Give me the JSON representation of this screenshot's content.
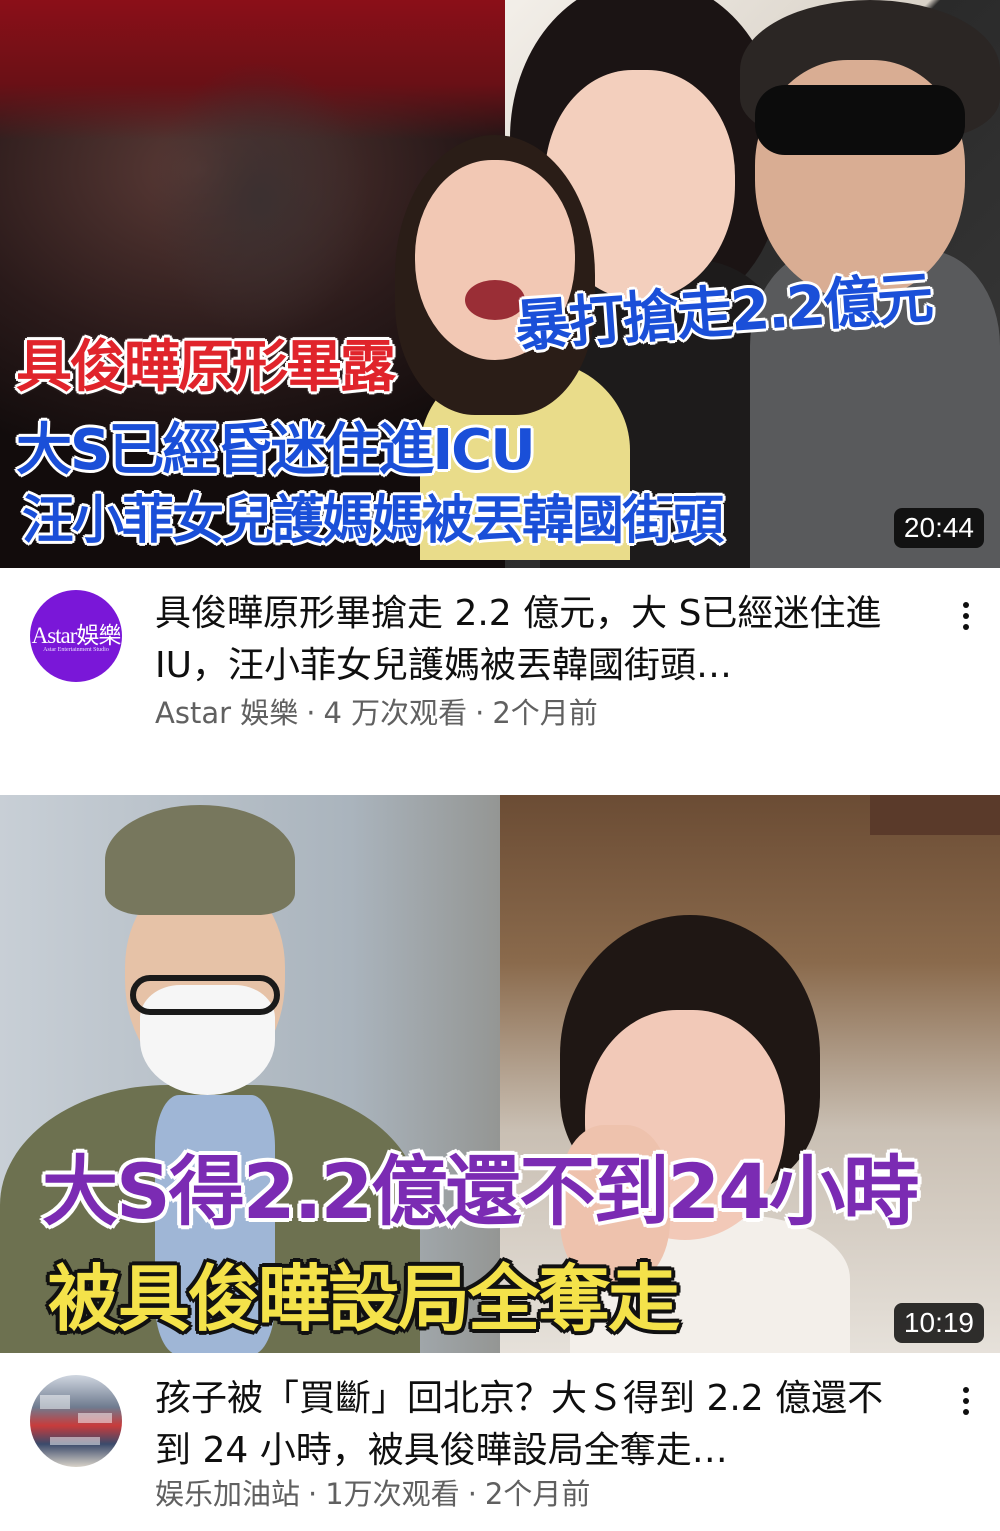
{
  "videos": [
    {
      "thumbnail_text": {
        "line1": "具俊曄原形畢露",
        "line2": "大S已經昏迷住進ICU",
        "line3": "汪小菲女兒護媽媽被丟韓國街頭",
        "line4": "暴打搶走2.2億元"
      },
      "duration": "20:44",
      "avatar_text": "Astar娛樂",
      "avatar_subtext": "Astar Entertainment Studio",
      "title": "具俊曄原形畢搶走 2.2 億元，大 S已經迷住進 IU，汪小菲女兒護媽被丟韓國街頭…",
      "channel": "Astar 娛樂",
      "views": "4 万次观看",
      "age": "2个月前",
      "separator": "·"
    },
    {
      "thumbnail_text": {
        "line1": "大S得2.2億還不到24小時",
        "line2": "被具俊曄設局全奪走"
      },
      "duration": "10:19",
      "title": "孩子被「買斷」回北京？大Ｓ得到 2.2 億還不到 24 小時，被具俊曄設局全奪走…",
      "channel": "娱乐加油站",
      "views": "1万次观看",
      "age": "2个月前",
      "separator": "·"
    }
  ]
}
